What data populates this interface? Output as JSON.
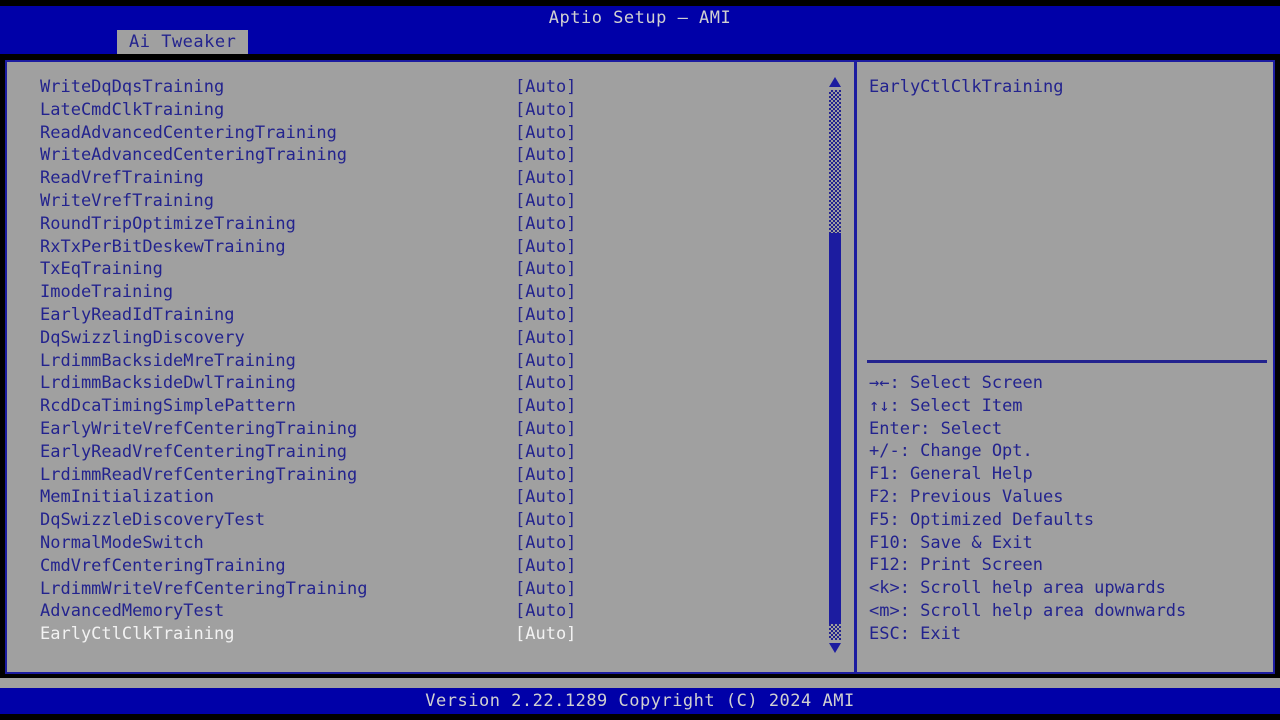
{
  "window": {
    "title": "Aptio Setup – AMI"
  },
  "tabs": [
    {
      "label": "Ai Tweaker",
      "active": true
    }
  ],
  "options": {
    "value_column_header": "",
    "items": [
      {
        "name": "WriteDqDqsTraining",
        "value": "[Auto]",
        "selected": false
      },
      {
        "name": "LateCmdClkTraining",
        "value": "[Auto]",
        "selected": false
      },
      {
        "name": "ReadAdvancedCenteringTraining",
        "value": "[Auto]",
        "selected": false
      },
      {
        "name": "WriteAdvancedCenteringTraining",
        "value": "[Auto]",
        "selected": false
      },
      {
        "name": "ReadVrefTraining",
        "value": "[Auto]",
        "selected": false
      },
      {
        "name": "WriteVrefTraining",
        "value": "[Auto]",
        "selected": false
      },
      {
        "name": "RoundTripOptimizeTraining",
        "value": "[Auto]",
        "selected": false
      },
      {
        "name": "RxTxPerBitDeskewTraining",
        "value": "[Auto]",
        "selected": false
      },
      {
        "name": "TxEqTraining",
        "value": "[Auto]",
        "selected": false
      },
      {
        "name": "ImodeTraining",
        "value": "[Auto]",
        "selected": false
      },
      {
        "name": "EarlyReadIdTraining",
        "value": "[Auto]",
        "selected": false
      },
      {
        "name": "DqSwizzlingDiscovery",
        "value": "[Auto]",
        "selected": false
      },
      {
        "name": "LrdimmBacksideMreTraining",
        "value": "[Auto]",
        "selected": false
      },
      {
        "name": "LrdimmBacksideDwlTraining",
        "value": "[Auto]",
        "selected": false
      },
      {
        "name": "RcdDcaTimingSimplePattern",
        "value": "[Auto]",
        "selected": false
      },
      {
        "name": "EarlyWriteVrefCenteringTraining",
        "value": "[Auto]",
        "selected": false
      },
      {
        "name": "EarlyReadVrefCenteringTraining",
        "value": "[Auto]",
        "selected": false
      },
      {
        "name": "LrdimmReadVrefCenteringTraining",
        "value": "[Auto]",
        "selected": false
      },
      {
        "name": "MemInitialization",
        "value": "[Auto]",
        "selected": false
      },
      {
        "name": "DqSwizzleDiscoveryTest",
        "value": "[Auto]",
        "selected": false
      },
      {
        "name": "NormalModeSwitch",
        "value": "[Auto]",
        "selected": false
      },
      {
        "name": "CmdVrefCenteringTraining",
        "value": "[Auto]",
        "selected": false
      },
      {
        "name": "LrdimmWriteVrefCenteringTraining",
        "value": "[Auto]",
        "selected": false
      },
      {
        "name": "AdvancedMemoryTest",
        "value": "[Auto]",
        "selected": false
      },
      {
        "name": "EarlyCtlClkTraining",
        "value": "[Auto]",
        "selected": true
      }
    ]
  },
  "scrollbar": {
    "up_arrow_icon": "triangle-up-icon",
    "down_arrow_icon": "triangle-down-icon",
    "thumb_top_pct": 26,
    "thumb_height_pct": 71
  },
  "help": {
    "description": "EarlyCtlClkTraining",
    "keys": [
      {
        "glyphs": "→←",
        "text": ": Select Screen"
      },
      {
        "glyphs": "↑↓",
        "text": ": Select Item"
      },
      {
        "glyphs": "",
        "text": "Enter: Select"
      },
      {
        "glyphs": "",
        "text": "+/-: Change Opt."
      },
      {
        "glyphs": "",
        "text": "F1: General Help"
      },
      {
        "glyphs": "",
        "text": "F2: Previous Values"
      },
      {
        "glyphs": "",
        "text": "F5: Optimized Defaults"
      },
      {
        "glyphs": "",
        "text": "F10: Save & Exit"
      },
      {
        "glyphs": "",
        "text": "F12: Print Screen"
      },
      {
        "glyphs": "",
        "text": "<k>: Scroll help area upwards"
      },
      {
        "glyphs": "",
        "text": "<m>: Scroll help area downwards"
      },
      {
        "glyphs": "",
        "text": "ESC: Exit"
      }
    ]
  },
  "footer": {
    "version_text": "Version 2.22.1289 Copyright (C) 2024 AMI"
  },
  "colors": {
    "background_gray": "#a0a0a0",
    "bar_blue": "#0000a8",
    "text_blue": "#23238e",
    "selected_text": "#f2f2f2",
    "border_blue": "#1c1ca0",
    "bar_text": "#d0d0d0"
  }
}
